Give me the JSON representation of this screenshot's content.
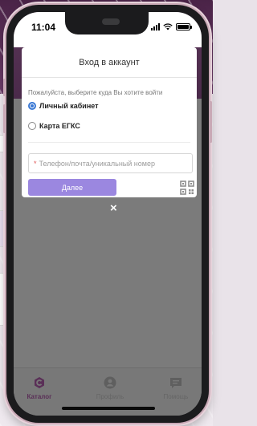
{
  "status_bar": {
    "time": "11:04"
  },
  "modal": {
    "title": "Вход в аккаунт",
    "hint": "Пожалуйста, выберите куда Вы хотите войти",
    "options": [
      {
        "label": "Личный кабинет",
        "selected": true
      },
      {
        "label": "Карта ЕГКС",
        "selected": false
      }
    ],
    "input_placeholder": "Телефон/почта/уникальный номер",
    "required_mark": "*",
    "submit_label": "Далее",
    "close_symbol": "×"
  },
  "tabbar": {
    "tabs": [
      {
        "label": "Каталог",
        "icon": "catalog-icon",
        "active": true
      },
      {
        "label": "Профиль",
        "icon": "profile-icon",
        "active": false
      },
      {
        "label": "Помощь",
        "icon": "help-icon",
        "active": false
      }
    ]
  },
  "colors": {
    "accent": "#9b87e0",
    "radio": "#3a78d4",
    "brand": "#5a2f57",
    "required": "#e05858"
  }
}
